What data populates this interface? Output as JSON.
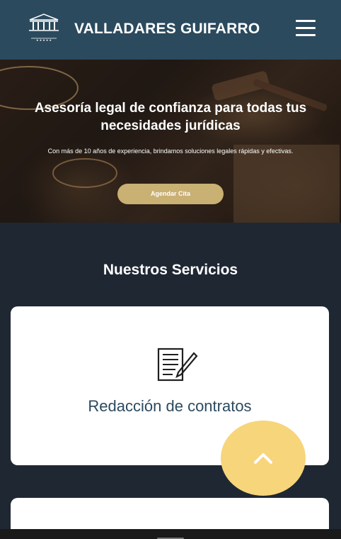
{
  "header": {
    "brand": "VALLADARES GUIFARRO",
    "logo_text": "Valladares Guifarro",
    "logo_icon": "courthouse-icon",
    "menu_icon": "hamburger-icon"
  },
  "hero": {
    "title": "Asesoría legal de confianza para todas tus necesidades jurídicas",
    "subtitle": "Con más de 10 años de experiencia, brindamos soluciones legales rápidas y efectivas.",
    "cta_label": "Agendar Cita"
  },
  "services": {
    "title": "Nuestros Servicios",
    "items": [
      {
        "label": "Redacción de contratos",
        "icon": "contract-pen-icon"
      },
      {
        "label": "",
        "icon": ""
      }
    ]
  },
  "scroll_top": {
    "icon": "chevron-up-icon"
  },
  "colors": {
    "header_bg": "#2b4a5e",
    "page_bg": "#1f2733",
    "accent": "#c9b073",
    "fab": "#f7d57a"
  }
}
